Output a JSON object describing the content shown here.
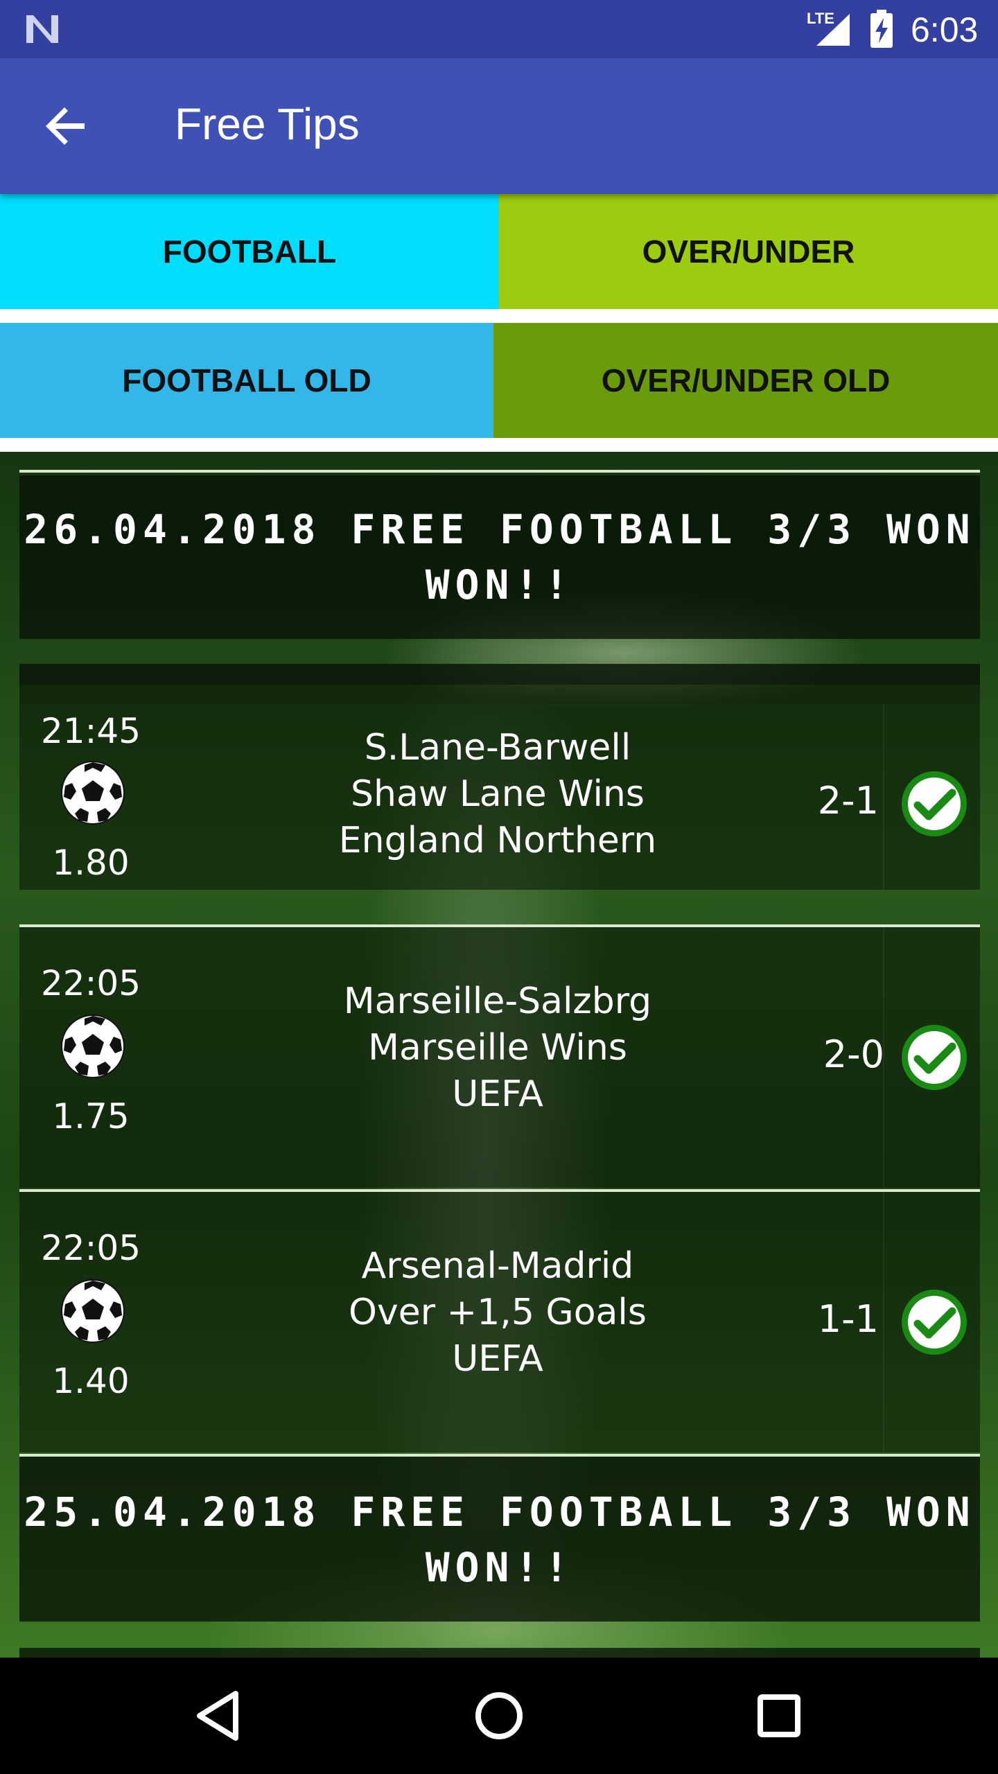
{
  "status_bar": {
    "network": "LTE",
    "time": "6:03"
  },
  "app_bar": {
    "title": "Free Tips",
    "back_icon": "arrow-back-icon"
  },
  "tabs": {
    "football": "FOOTBALL",
    "over_under": "OVER/UNDER",
    "football_old": "FOOTBALL OLD",
    "over_under_old": "OVER/UNDER OLD"
  },
  "sections": [
    {
      "header": "26.04.2018 FREE FOOTBALL 3/3 WON WON!!",
      "matches": [
        {
          "time": "21:45",
          "odds": "1.80",
          "match": "S.Lane-Barwell",
          "tip": "Shaw Lane Wins",
          "league": "England Northern",
          "score": "2-1",
          "result_icon": "check-circle-icon"
        },
        {
          "time": "22:05",
          "odds": "1.75",
          "match": "Marseille-Salzbrg",
          "tip": "Marseille Wins",
          "league": "UEFA",
          "score": "2-0",
          "result_icon": "check-circle-icon"
        },
        {
          "time": "22:05",
          "odds": "1.40",
          "match": "Arsenal-Madrid",
          "tip": "Over +1,5 Goals",
          "league": "UEFA",
          "score": "1-1",
          "result_icon": "check-circle-icon"
        }
      ]
    },
    {
      "header": "25.04.2018 FREE FOOTBALL 3/3 WON WON!!"
    }
  ],
  "colors": {
    "status_bar": "#3340a0",
    "app_bar": "#3f51b5",
    "tab_football": "#00ddfd",
    "tab_over_under": "#9ccc0f",
    "tab_football_old": "#33b6e8",
    "tab_over_under_old": "#6a9b0a",
    "check_green": "#1a8a14"
  },
  "nav_bar": {
    "back": "nav-back-icon",
    "home": "nav-home-icon",
    "recents": "nav-recents-icon"
  }
}
